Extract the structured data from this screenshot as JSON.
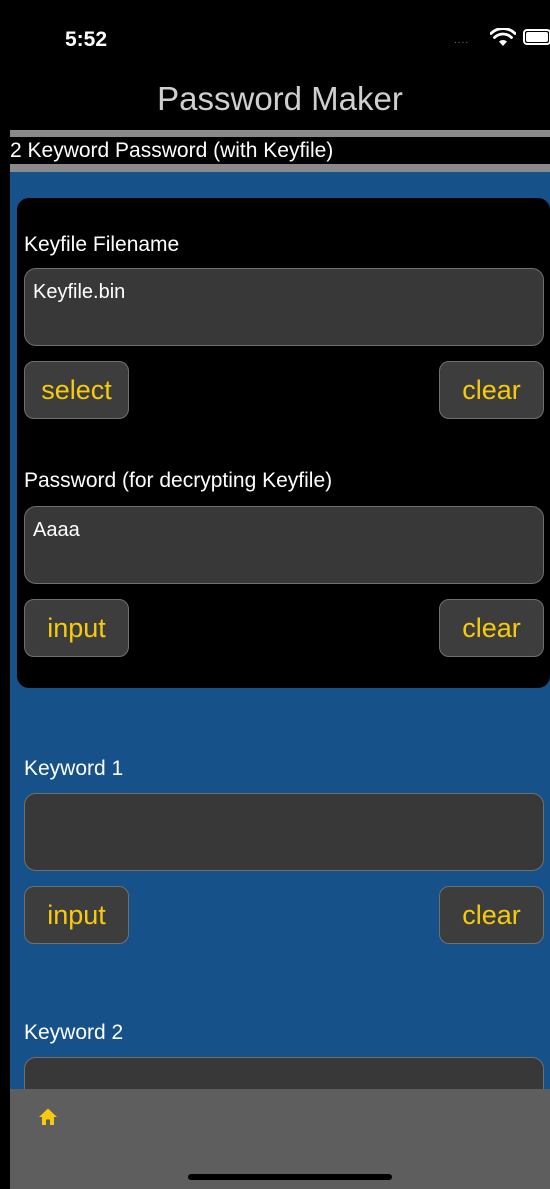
{
  "status": {
    "time": "5:52",
    "signal_dots": "....",
    "wifi_icon": "wifi-icon",
    "battery_icon": "battery-icon"
  },
  "nav": {
    "title": "Password Maker"
  },
  "mode": {
    "label": "2 Keyword Password (with Keyfile)"
  },
  "keyfile": {
    "label": "Keyfile Filename",
    "value": "Keyfile.bin",
    "select_label": "select",
    "clear_label": "clear"
  },
  "password": {
    "label": "Password (for decrypting Keyfile)",
    "value": "Aaaa",
    "input_label": "input",
    "clear_label": "clear"
  },
  "keyword1": {
    "label": "Keyword 1",
    "value": "",
    "input_label": "input",
    "clear_label": "clear"
  },
  "keyword2": {
    "label": "Keyword 2",
    "value": ""
  },
  "tabbar": {
    "home_icon": "home-icon"
  },
  "colors": {
    "background": "#16518a",
    "button_text": "#f7cb0d",
    "field_bg": "#383838",
    "card_bg": "#000000",
    "tabbar_bg": "#5e5e5e"
  }
}
